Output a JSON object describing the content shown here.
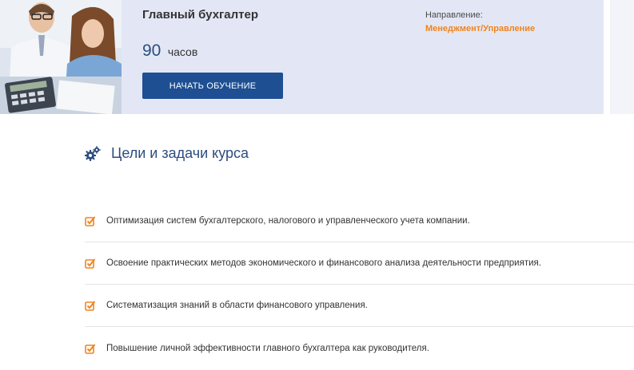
{
  "course": {
    "title": "Главный бухгалтер",
    "hours": "90",
    "hours_unit": "часов",
    "start_button": "НАЧАТЬ ОБУЧЕНИЕ",
    "direction_label": "Направление:",
    "direction_value": "Менеджмент/Управление"
  },
  "goals_section": {
    "title": "Цели и задачи курса",
    "icon": "gears-icon",
    "items": [
      "Оптимизация систем бухгалтерского, налогового и управленческого учета компании.",
      "Освоение практических методов экономического и финансового анализа деятельности предприятия.",
      "Систематизация знаний в области финансового управления.",
      "Повышение личной эффективности главного бухгалтера как руководителя."
    ]
  },
  "colors": {
    "banner_bg": "#e3e7f5",
    "button_bg": "#1d4f92",
    "accent_orange": "#f0841f",
    "heading_blue": "#2c4d7f"
  }
}
